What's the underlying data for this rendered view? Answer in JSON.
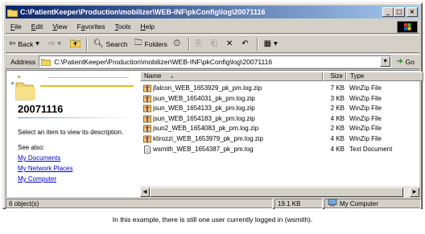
{
  "window": {
    "title": "C:\\PatientKeeper\\Production\\mobilizer\\WEB-INF\\pkConfig\\log\\20071116",
    "controls": {
      "minimize": "_",
      "maximize": "□",
      "close": "×"
    }
  },
  "menu": {
    "items": [
      "File",
      "Edit",
      "View",
      "Favorites",
      "Tools",
      "Help"
    ],
    "mnemonics": [
      "F",
      "E",
      "V",
      "a",
      "T",
      "H"
    ]
  },
  "toolbar": {
    "back_label": "Back",
    "search_label": "Search",
    "folders_label": "Folders"
  },
  "address": {
    "label": "Address",
    "value": "C:\\PatientKeeper\\Production\\mobilizer\\WEB-INF\\pkConfig\\log\\20071116",
    "go_label": "Go"
  },
  "left_pane": {
    "folder_name": "20071116",
    "hint": "Select an item to view its description.",
    "see_also": "See also:",
    "links": [
      "My Documents",
      "My Network Places",
      "My Computer"
    ]
  },
  "file_list": {
    "columns": [
      "Name",
      "Size",
      "Type"
    ],
    "sort_indicator": "▲",
    "rows": [
      {
        "name": "jfalcon_WEB_1653929_pk_pm.log.zip",
        "size": "7 KB",
        "type": "WinZip File",
        "icon": "zip-icon"
      },
      {
        "name": "jsun_WEB_1654031_pk_pm.log.zip",
        "size": "3 KB",
        "type": "WinZip File",
        "icon": "zip-icon"
      },
      {
        "name": "jsun_WEB_1654133_pk_pm.log.zip",
        "size": "2 KB",
        "type": "WinZip File",
        "icon": "zip-icon"
      },
      {
        "name": "jsun_WEB_1654183_pk_pm.log.zip",
        "size": "4 KB",
        "type": "WinZip File",
        "icon": "zip-icon"
      },
      {
        "name": "jsun2_WEB_1654083_pk_pm.log.zip",
        "size": "2 KB",
        "type": "WinZip File",
        "icon": "zip-icon"
      },
      {
        "name": "ktirozzi_WEB_1653979_pk_pm.log.zip",
        "size": "4 KB",
        "type": "WinZip File",
        "icon": "zip-icon"
      },
      {
        "name": "wsmith_WEB_1654387_pk_pm.log",
        "size": "4 KB",
        "type": "Text Document",
        "icon": "text-file-icon"
      }
    ]
  },
  "status": {
    "objects": "6 object(s)",
    "size": "19.1 KB",
    "location": "My Computer"
  },
  "caption": "In this example, there is still one user currently logged in (wsmith).",
  "colors": {
    "title_start": "#0a246a",
    "title_end": "#a6caf0",
    "link": "#0000cc",
    "chrome": "#d4d0c8"
  }
}
